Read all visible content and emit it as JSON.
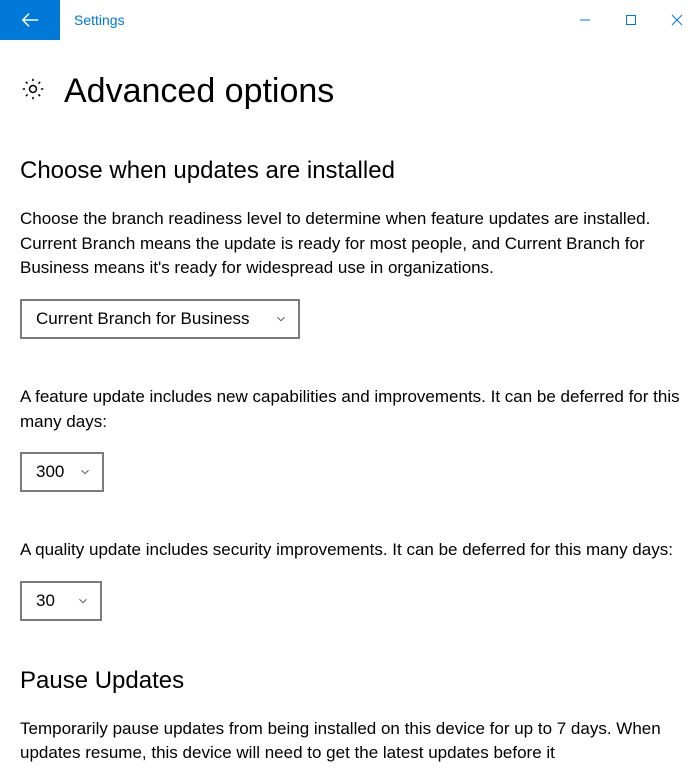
{
  "window": {
    "title": "Settings"
  },
  "page": {
    "heading": "Advanced options"
  },
  "section_install": {
    "heading": "Choose when updates are installed",
    "branch_description": "Choose the branch readiness level to determine when feature updates are installed. Current Branch means the update is ready for most people, and Current Branch for Business means it's ready for widespread use in organizations.",
    "branch_dropdown": {
      "selected": "Current Branch for Business"
    },
    "feature_defer_text": "A feature update includes new capabilities and improvements. It can be deferred for this many days:",
    "feature_defer_dropdown": {
      "selected": "300"
    },
    "quality_defer_text": "A quality update includes security improvements. It can be deferred for this many days:",
    "quality_defer_dropdown": {
      "selected": "30"
    }
  },
  "section_pause": {
    "heading": "Pause Updates",
    "description": "Temporarily pause updates from being installed on this device for up to 7 days. When updates resume, this device will need to get the latest updates before it"
  }
}
